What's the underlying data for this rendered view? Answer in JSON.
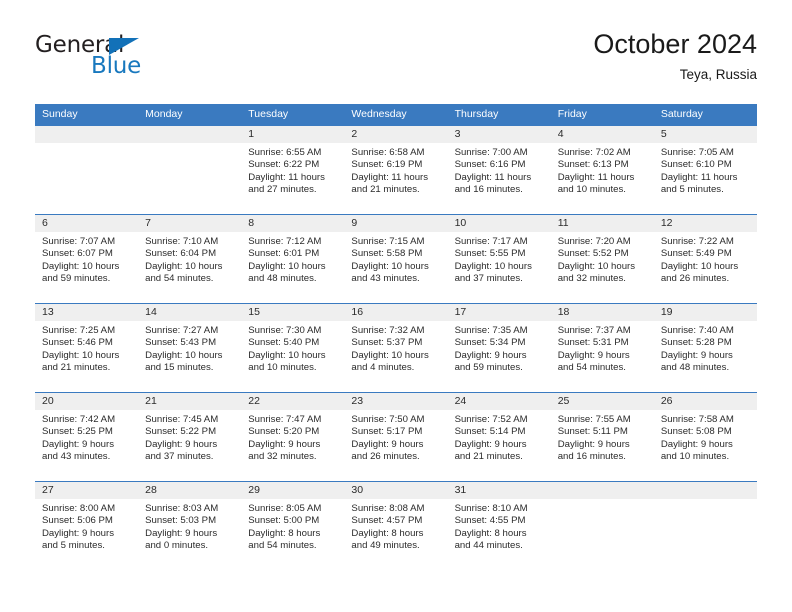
{
  "brand": {
    "name_part1": "General",
    "name_part2": "Blue",
    "triangle_color": "#1271b8"
  },
  "header": {
    "month_title": "October 2024",
    "location": "Teya, Russia"
  },
  "colors": {
    "header_blue": "#3a7ac0",
    "day_strip_gray": "#efefef",
    "text": "#2b2b2b"
  },
  "weekdays": [
    "Sunday",
    "Monday",
    "Tuesday",
    "Wednesday",
    "Thursday",
    "Friday",
    "Saturday"
  ],
  "weeks": [
    [
      {
        "day": "",
        "sunrise": "",
        "sunset": "",
        "daylight": ""
      },
      {
        "day": "",
        "sunrise": "",
        "sunset": "",
        "daylight": ""
      },
      {
        "day": "1",
        "sunrise": "Sunrise: 6:55 AM",
        "sunset": "Sunset: 6:22 PM",
        "daylight": "Daylight: 11 hours and 27 minutes."
      },
      {
        "day": "2",
        "sunrise": "Sunrise: 6:58 AM",
        "sunset": "Sunset: 6:19 PM",
        "daylight": "Daylight: 11 hours and 21 minutes."
      },
      {
        "day": "3",
        "sunrise": "Sunrise: 7:00 AM",
        "sunset": "Sunset: 6:16 PM",
        "daylight": "Daylight: 11 hours and 16 minutes."
      },
      {
        "day": "4",
        "sunrise": "Sunrise: 7:02 AM",
        "sunset": "Sunset: 6:13 PM",
        "daylight": "Daylight: 11 hours and 10 minutes."
      },
      {
        "day": "5",
        "sunrise": "Sunrise: 7:05 AM",
        "sunset": "Sunset: 6:10 PM",
        "daylight": "Daylight: 11 hours and 5 minutes."
      }
    ],
    [
      {
        "day": "6",
        "sunrise": "Sunrise: 7:07 AM",
        "sunset": "Sunset: 6:07 PM",
        "daylight": "Daylight: 10 hours and 59 minutes."
      },
      {
        "day": "7",
        "sunrise": "Sunrise: 7:10 AM",
        "sunset": "Sunset: 6:04 PM",
        "daylight": "Daylight: 10 hours and 54 minutes."
      },
      {
        "day": "8",
        "sunrise": "Sunrise: 7:12 AM",
        "sunset": "Sunset: 6:01 PM",
        "daylight": "Daylight: 10 hours and 48 minutes."
      },
      {
        "day": "9",
        "sunrise": "Sunrise: 7:15 AM",
        "sunset": "Sunset: 5:58 PM",
        "daylight": "Daylight: 10 hours and 43 minutes."
      },
      {
        "day": "10",
        "sunrise": "Sunrise: 7:17 AM",
        "sunset": "Sunset: 5:55 PM",
        "daylight": "Daylight: 10 hours and 37 minutes."
      },
      {
        "day": "11",
        "sunrise": "Sunrise: 7:20 AM",
        "sunset": "Sunset: 5:52 PM",
        "daylight": "Daylight: 10 hours and 32 minutes."
      },
      {
        "day": "12",
        "sunrise": "Sunrise: 7:22 AM",
        "sunset": "Sunset: 5:49 PM",
        "daylight": "Daylight: 10 hours and 26 minutes."
      }
    ],
    [
      {
        "day": "13",
        "sunrise": "Sunrise: 7:25 AM",
        "sunset": "Sunset: 5:46 PM",
        "daylight": "Daylight: 10 hours and 21 minutes."
      },
      {
        "day": "14",
        "sunrise": "Sunrise: 7:27 AM",
        "sunset": "Sunset: 5:43 PM",
        "daylight": "Daylight: 10 hours and 15 minutes."
      },
      {
        "day": "15",
        "sunrise": "Sunrise: 7:30 AM",
        "sunset": "Sunset: 5:40 PM",
        "daylight": "Daylight: 10 hours and 10 minutes."
      },
      {
        "day": "16",
        "sunrise": "Sunrise: 7:32 AM",
        "sunset": "Sunset: 5:37 PM",
        "daylight": "Daylight: 10 hours and 4 minutes."
      },
      {
        "day": "17",
        "sunrise": "Sunrise: 7:35 AM",
        "sunset": "Sunset: 5:34 PM",
        "daylight": "Daylight: 9 hours and 59 minutes."
      },
      {
        "day": "18",
        "sunrise": "Sunrise: 7:37 AM",
        "sunset": "Sunset: 5:31 PM",
        "daylight": "Daylight: 9 hours and 54 minutes."
      },
      {
        "day": "19",
        "sunrise": "Sunrise: 7:40 AM",
        "sunset": "Sunset: 5:28 PM",
        "daylight": "Daylight: 9 hours and 48 minutes."
      }
    ],
    [
      {
        "day": "20",
        "sunrise": "Sunrise: 7:42 AM",
        "sunset": "Sunset: 5:25 PM",
        "daylight": "Daylight: 9 hours and 43 minutes."
      },
      {
        "day": "21",
        "sunrise": "Sunrise: 7:45 AM",
        "sunset": "Sunset: 5:22 PM",
        "daylight": "Daylight: 9 hours and 37 minutes."
      },
      {
        "day": "22",
        "sunrise": "Sunrise: 7:47 AM",
        "sunset": "Sunset: 5:20 PM",
        "daylight": "Daylight: 9 hours and 32 minutes."
      },
      {
        "day": "23",
        "sunrise": "Sunrise: 7:50 AM",
        "sunset": "Sunset: 5:17 PM",
        "daylight": "Daylight: 9 hours and 26 minutes."
      },
      {
        "day": "24",
        "sunrise": "Sunrise: 7:52 AM",
        "sunset": "Sunset: 5:14 PM",
        "daylight": "Daylight: 9 hours and 21 minutes."
      },
      {
        "day": "25",
        "sunrise": "Sunrise: 7:55 AM",
        "sunset": "Sunset: 5:11 PM",
        "daylight": "Daylight: 9 hours and 16 minutes."
      },
      {
        "day": "26",
        "sunrise": "Sunrise: 7:58 AM",
        "sunset": "Sunset: 5:08 PM",
        "daylight": "Daylight: 9 hours and 10 minutes."
      }
    ],
    [
      {
        "day": "27",
        "sunrise": "Sunrise: 8:00 AM",
        "sunset": "Sunset: 5:06 PM",
        "daylight": "Daylight: 9 hours and 5 minutes."
      },
      {
        "day": "28",
        "sunrise": "Sunrise: 8:03 AM",
        "sunset": "Sunset: 5:03 PM",
        "daylight": "Daylight: 9 hours and 0 minutes."
      },
      {
        "day": "29",
        "sunrise": "Sunrise: 8:05 AM",
        "sunset": "Sunset: 5:00 PM",
        "daylight": "Daylight: 8 hours and 54 minutes."
      },
      {
        "day": "30",
        "sunrise": "Sunrise: 8:08 AM",
        "sunset": "Sunset: 4:57 PM",
        "daylight": "Daylight: 8 hours and 49 minutes."
      },
      {
        "day": "31",
        "sunrise": "Sunrise: 8:10 AM",
        "sunset": "Sunset: 4:55 PM",
        "daylight": "Daylight: 8 hours and 44 minutes."
      },
      {
        "day": "",
        "sunrise": "",
        "sunset": "",
        "daylight": ""
      },
      {
        "day": "",
        "sunrise": "",
        "sunset": "",
        "daylight": ""
      }
    ]
  ]
}
